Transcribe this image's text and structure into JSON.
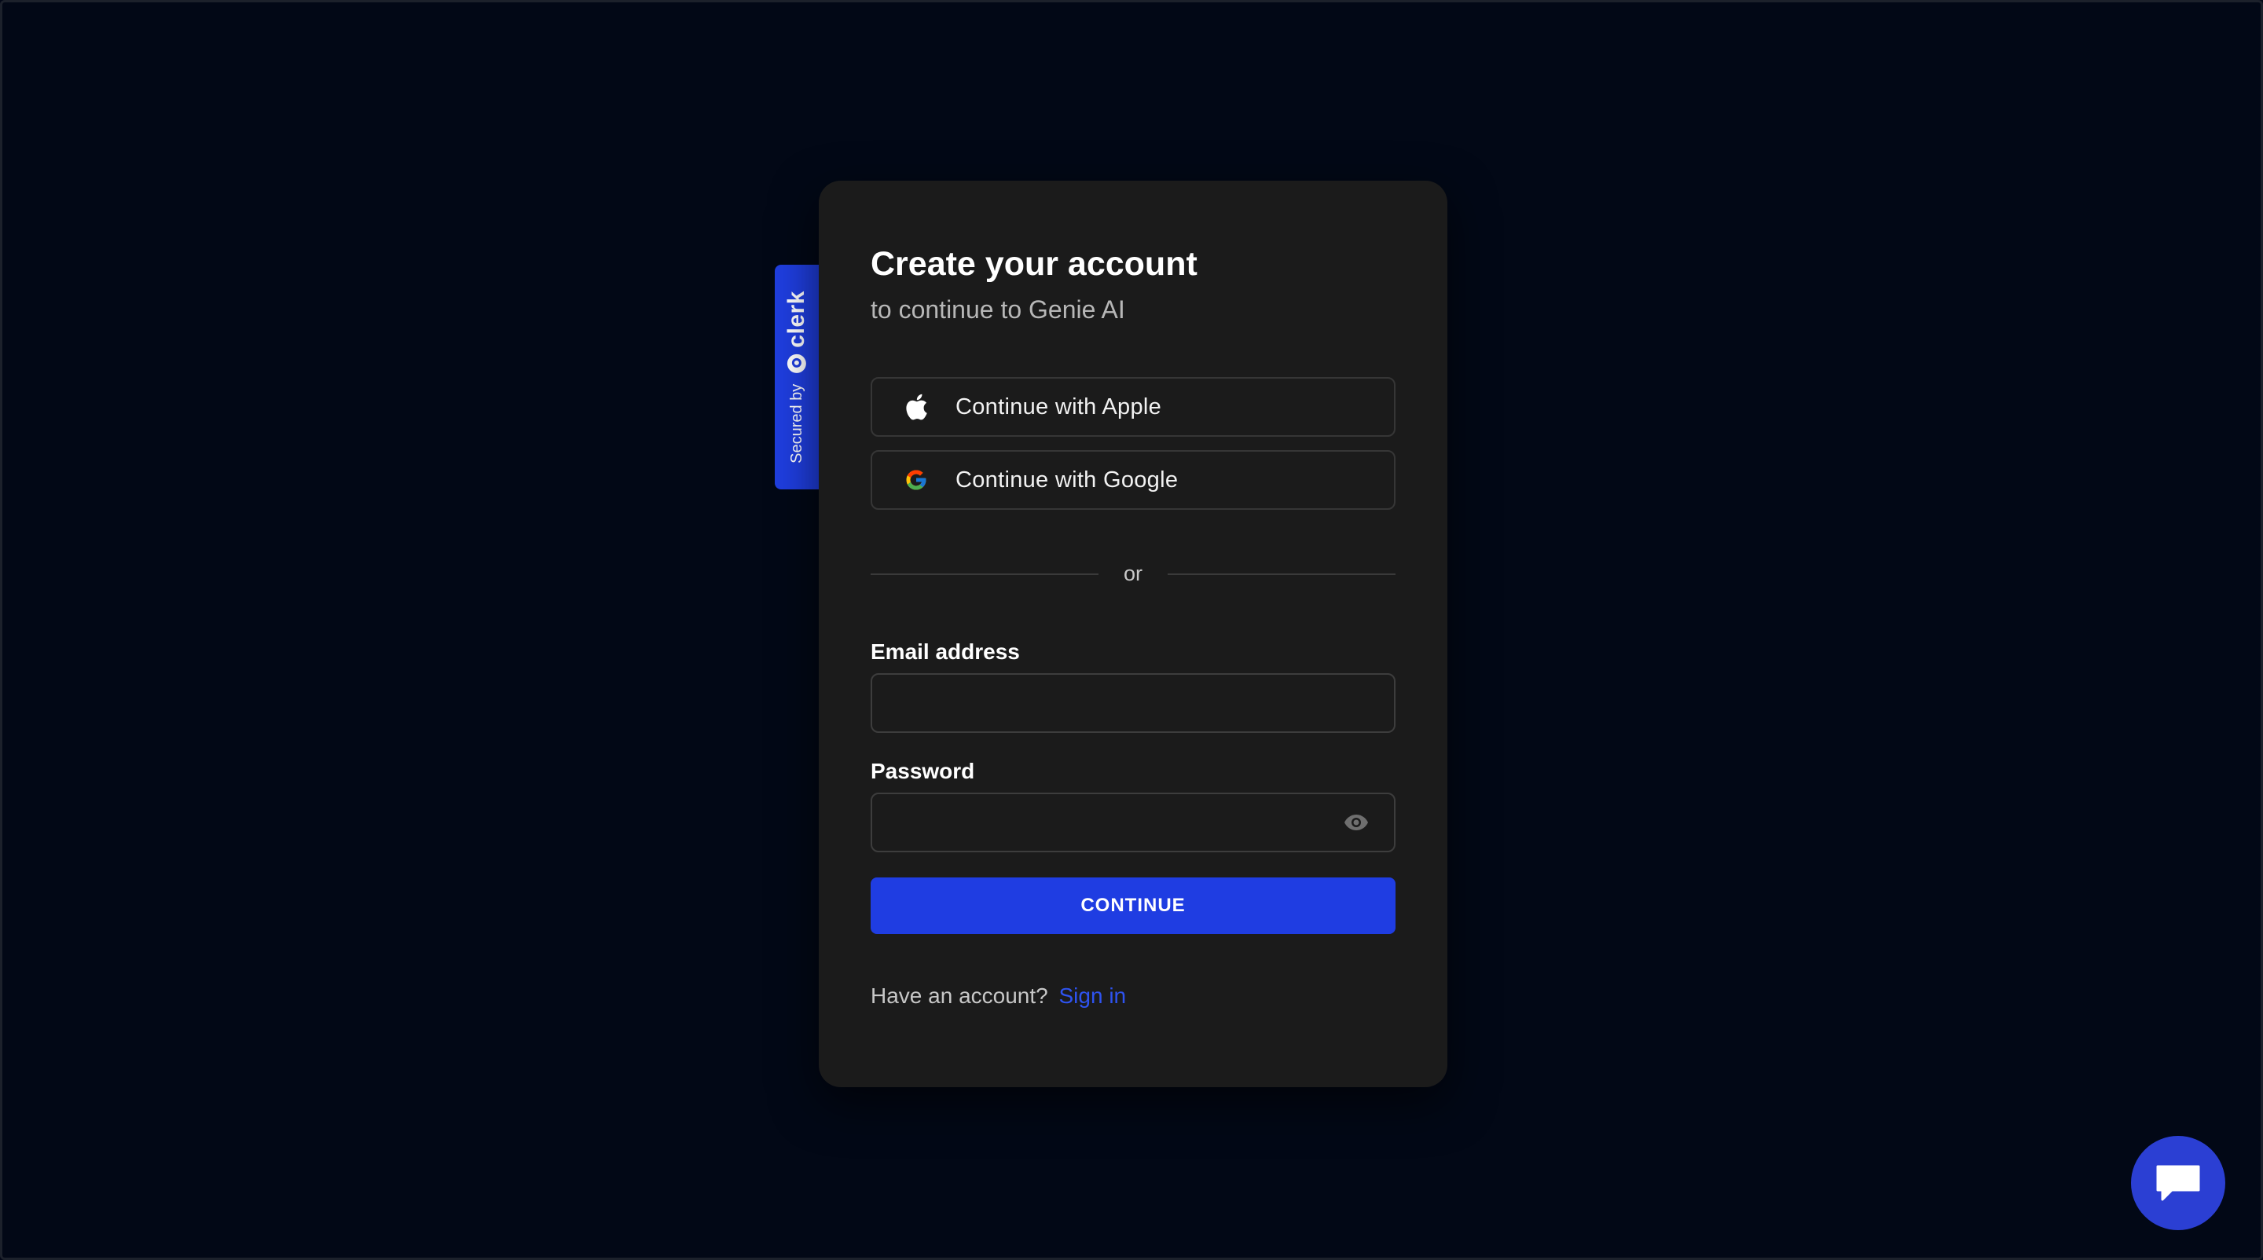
{
  "badge": {
    "secured_label": "Secured by",
    "brand_label": "clerk"
  },
  "card": {
    "title": "Create your account",
    "subtitle": "to continue to Genie AI"
  },
  "social": {
    "apple_label": "Continue with Apple",
    "google_label": "Continue with Google"
  },
  "divider": {
    "label": "or"
  },
  "form": {
    "email_label": "Email address",
    "email_value": "",
    "password_label": "Password",
    "password_value": "",
    "continue_label": "CONTINUE"
  },
  "footer": {
    "prompt": "Have an account?",
    "sign_in_link": "Sign in"
  },
  "colors": {
    "background": "#020816",
    "card": "#1b1b1b",
    "accent": "#1f3de2",
    "chat_button": "#2b3fd3"
  },
  "icons": {
    "apple": "apple-icon",
    "google": "google-icon",
    "eye": "eye-icon",
    "chat": "chat-bubble-icon",
    "clerk": "clerk-logo-icon"
  }
}
